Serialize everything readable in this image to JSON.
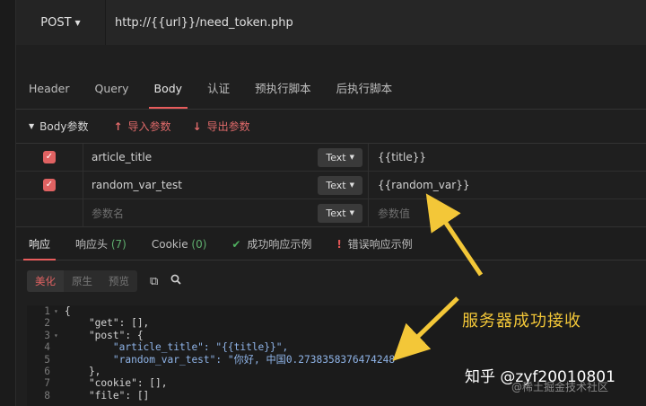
{
  "request": {
    "method": "POST",
    "url": "http://{{url}}/need_token.php"
  },
  "tabs": [
    "Header",
    "Query",
    "Body",
    "认证",
    "预执行脚本",
    "后执行脚本"
  ],
  "active_tab": "Body",
  "body_section": {
    "title": "Body参数",
    "import_label": "导入参数",
    "export_label": "导出参数"
  },
  "params": [
    {
      "name": "article_title",
      "type": "Text",
      "value": "{{title}}",
      "checked": true
    },
    {
      "name": "random_var_test",
      "type": "Text",
      "value": "{{random_var}}",
      "checked": true
    }
  ],
  "new_param": {
    "name_placeholder": "参数名",
    "type": "Text",
    "value_placeholder": "参数值"
  },
  "response_tabs": {
    "response": "响应",
    "headers": "响应头",
    "headers_count": "(7)",
    "cookie": "Cookie",
    "cookie_count": "(0)",
    "success_example": "成功响应示例",
    "error_example": "错误响应示例"
  },
  "view_modes": [
    "美化",
    "原生",
    "预览"
  ],
  "active_view_mode": "美化",
  "code_lines": [
    {
      "n": "1",
      "fold": "▾",
      "text": "{"
    },
    {
      "n": "2",
      "fold": "",
      "text": "    \"get\": [],"
    },
    {
      "n": "3",
      "fold": "▾",
      "text": "    \"post\": {"
    },
    {
      "n": "4",
      "fold": "",
      "text": "        \"article_title\": \"{{title}}\","
    },
    {
      "n": "5",
      "fold": "",
      "text": "        \"random_var_test\": \"你好, 中国0.2738358376474248\""
    },
    {
      "n": "6",
      "fold": "",
      "text": "    },"
    },
    {
      "n": "7",
      "fold": "",
      "text": "    \"cookie\": [],"
    },
    {
      "n": "8",
      "fold": "",
      "text": "    \"file\": []"
    }
  ],
  "annotation": "服务器成功接收",
  "watermark": {
    "main": "知乎 @zyf20010801",
    "sub": "@稀土掘金技术社区"
  },
  "colors": {
    "accent": "#e85c5c",
    "annotation": "#f3c738",
    "success": "#4fb05f"
  }
}
